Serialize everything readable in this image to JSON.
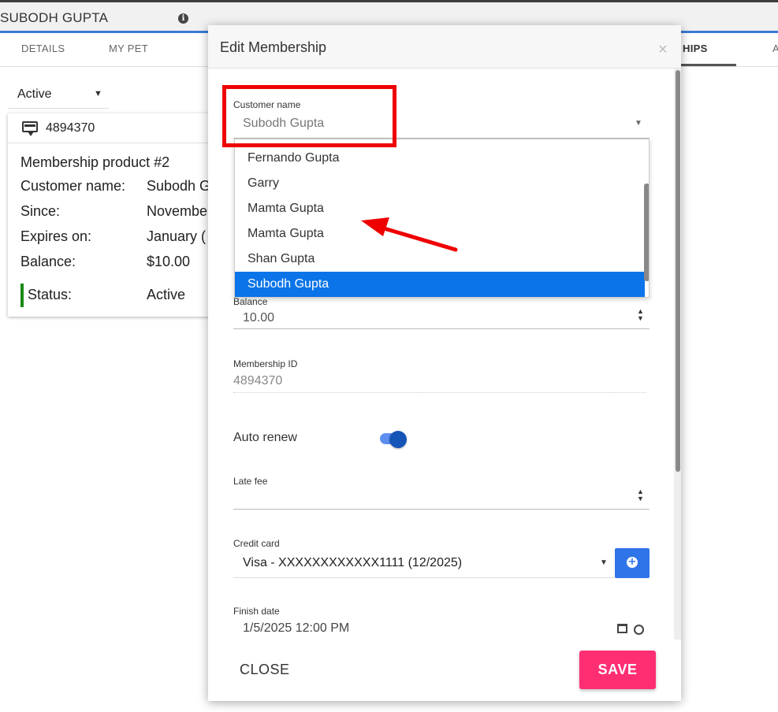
{
  "header": {
    "title": "SUBODH GUPTA",
    "info_icon": "info-icon"
  },
  "tabs": [
    {
      "label": "DETAILS"
    },
    {
      "label": "MY PET"
    },
    {
      "label": "HIPS"
    },
    {
      "label": "A"
    }
  ],
  "filter": {
    "value": "Active"
  },
  "card": {
    "id": "4894370",
    "product": "Membership product #2",
    "rows": [
      {
        "label": "Customer name:",
        "value": "Subodh G"
      },
      {
        "label": "Since:",
        "value": "Novembe"
      },
      {
        "label": "Expires on:",
        "value": "January ("
      },
      {
        "label": "Balance:",
        "value": "$10.00"
      },
      {
        "label": "Status:",
        "value": "Active"
      }
    ],
    "status_color": "#1a8a1a"
  },
  "modal": {
    "title": "Edit Membership",
    "close_glyph": "×",
    "customer": {
      "label": "Customer name",
      "value": "Subodh Gupta",
      "options": [
        "Fernando Gupta",
        "Garry",
        "Mamta Gupta",
        "Mamta Gupta",
        "Shan Gupta",
        "Subodh Gupta"
      ],
      "selected_index": 5
    },
    "balance": {
      "label": "Balance",
      "value": "10.00"
    },
    "membership_id": {
      "label": "Membership ID",
      "value": "4894370"
    },
    "auto_renew": {
      "label": "Auto renew",
      "on": true
    },
    "late_fee": {
      "label": "Late fee",
      "value": ""
    },
    "credit_card": {
      "label": "Credit card",
      "value": "Visa - XXXXXXXXXXXX1111 (12/2025)"
    },
    "finish_date": {
      "label": "Finish date",
      "value": "1/5/2025 12:00 PM"
    },
    "buttons": {
      "close": "CLOSE",
      "save": "SAVE"
    }
  },
  "colors": {
    "accent": "#3a7bd5",
    "save": "#ff2e73",
    "selected": "#0a74e8",
    "annotation": "#ee0000"
  }
}
